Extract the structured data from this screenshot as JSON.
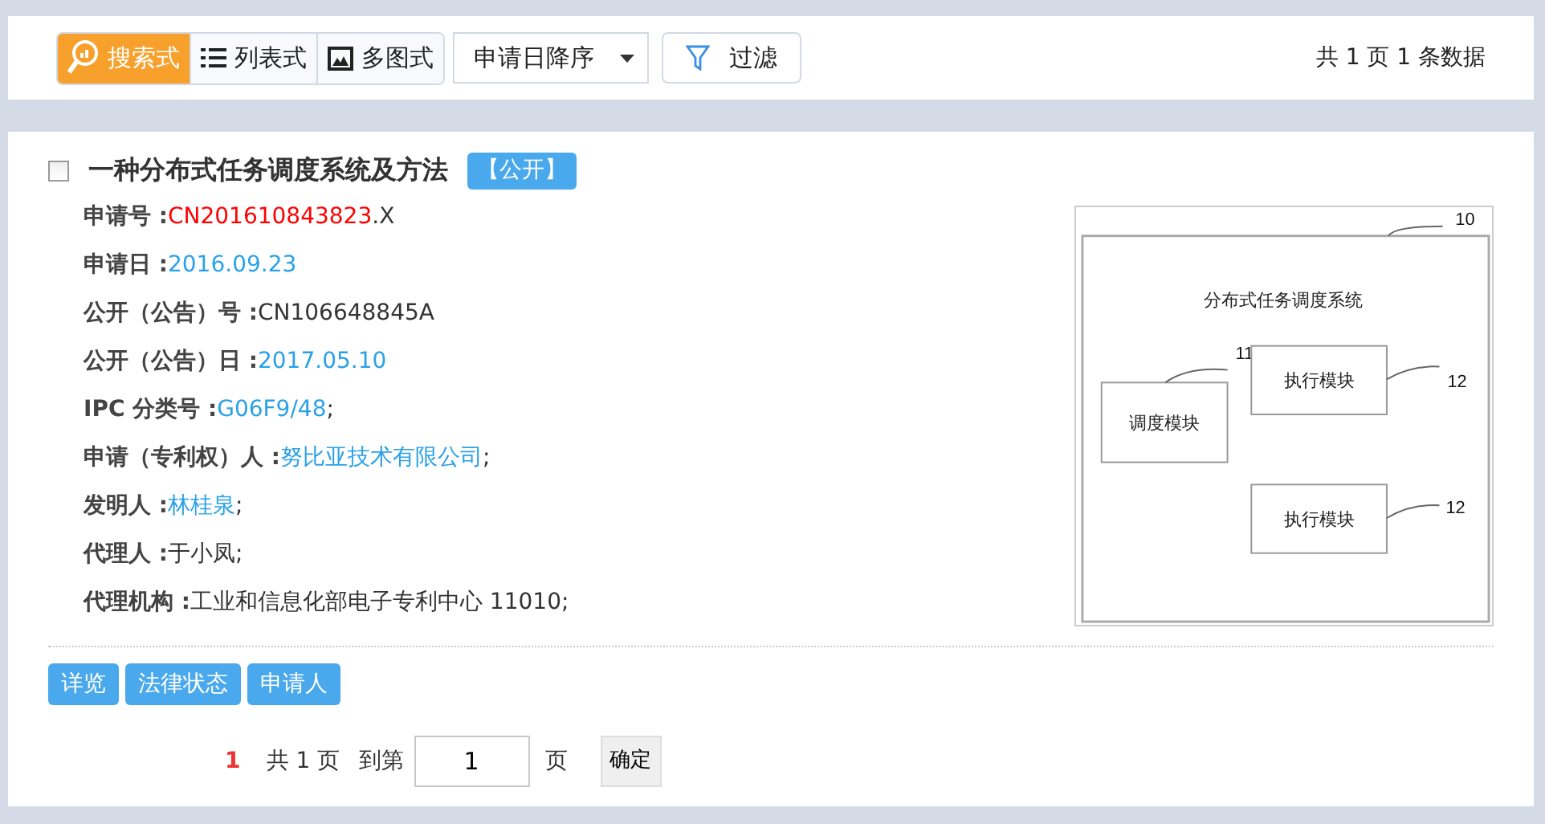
{
  "toolbar": {
    "views": [
      {
        "label": "搜索式",
        "kind": "search",
        "selected": true
      },
      {
        "label": "列表式",
        "kind": "list",
        "selected": false
      },
      {
        "label": "多图式",
        "kind": "image",
        "selected": false
      }
    ],
    "sort": {
      "value": "申请日降序"
    },
    "filter_button": "过滤",
    "summary": "共 1 页 1 条数据"
  },
  "result": {
    "checked": false,
    "title": "一种分布式任务调度系统及方法",
    "badge": "【公开】",
    "fields": [
      {
        "label": "申请号 :",
        "value": "CN201610843823",
        "kind": "highlight",
        "suffix": ".X"
      },
      {
        "label": "申请日 :",
        "value": "2016.09.23",
        "kind": "link"
      },
      {
        "label": "公开（公告）号 :",
        "value": "CN106648845A",
        "kind": "plain"
      },
      {
        "label": "公开（公告）日 :",
        "value": "2017.05.10",
        "kind": "link"
      },
      {
        "label": "IPC 分类号 :",
        "value": "G06F9/48",
        "kind": "link",
        "suffix": " ;"
      },
      {
        "label": "申请（专利权）人 :",
        "value": "努比亚技术有限公司",
        "kind": "link",
        "suffix": " ;"
      },
      {
        "label": "发明人 :",
        "value": "林桂泉",
        "kind": "link",
        "suffix": " ;"
      },
      {
        "label": "代理人 :",
        "value": "于小凤;",
        "kind": "plain"
      },
      {
        "label": "代理机构 :",
        "value": "工业和信息化部电子专利中心 11010;",
        "kind": "plain"
      }
    ],
    "figure": {
      "title": "分布式任务调度系统",
      "system_ref": "10",
      "modules": [
        {
          "label": "调度模块",
          "ref": "11"
        },
        {
          "label": "执行模块",
          "ref": "12"
        },
        {
          "label": "执行模块",
          "ref": "12"
        }
      ]
    },
    "actions": [
      "详览",
      "法律状态",
      "申请人"
    ]
  },
  "pagination": {
    "current": "1",
    "total": "共 1 页",
    "goto_label": "到第",
    "goto_value": "1",
    "page_unit": "页",
    "confirm": "确定"
  }
}
